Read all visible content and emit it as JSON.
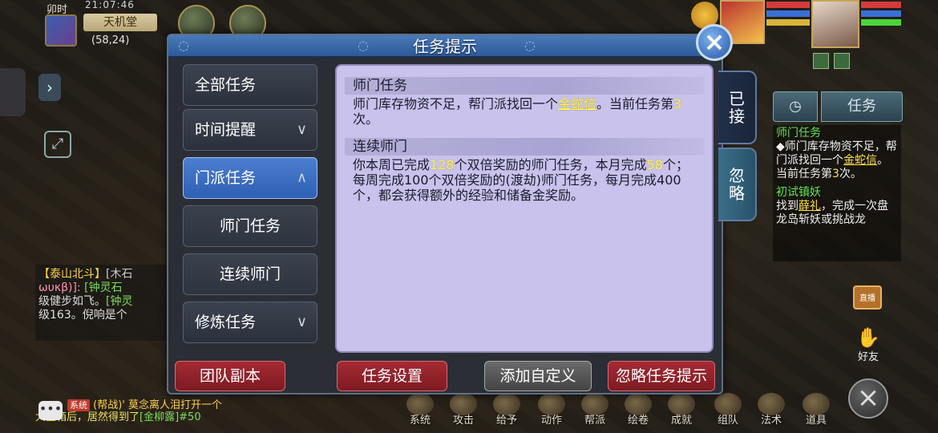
{
  "hud": {
    "time_slot": "卯时",
    "clock": "21:07:46",
    "location": "天机堂",
    "coords": "(58,24)"
  },
  "dialog": {
    "title": "任务提示",
    "categories": [
      {
        "label": "全部任务",
        "chevron": ""
      },
      {
        "label": "时间提醒",
        "chevron": "∨"
      },
      {
        "label": "门派任务",
        "chevron": "∧"
      },
      {
        "label": "师门任务",
        "chevron": ""
      },
      {
        "label": "连续师门",
        "chevron": ""
      },
      {
        "label": "修炼任务",
        "chevron": "∨"
      }
    ],
    "side_tabs": [
      "已接",
      "忽略"
    ],
    "sections": {
      "s1_title": "师门任务",
      "s1_t1": "师门库存物资不足，帮门派找回一个",
      "s1_item": "金蛇信",
      "s1_t2": "。当前任务第",
      "s1_num": "3",
      "s1_t3": "次。",
      "s2_title": "连续师门",
      "s2_t1": "你本周已完成",
      "s2_num1": "128",
      "s2_t2": "个双倍奖励的师门任务，本月完成",
      "s2_num2": "58",
      "s2_t3": "个；每周完成100个双倍奖励的(渡劫)师门任务，每月完成400个，都会获得额外的经验和储备金奖励。"
    },
    "buttons": {
      "team_dungeon": "团队副本",
      "task_settings": "任务设置",
      "add_custom": "添加自定义",
      "ignore_hint": "忽略任务提示"
    }
  },
  "tracker": {
    "timer_icon": "◷",
    "tab_label": "任务",
    "t1_title": "师门任务",
    "t1_a": "◆师门库存物资不足，帮门派找回一个",
    "t1_item": "金蛇信",
    "t1_b": "。当前任务第",
    "t1_num": "3",
    "t1_c": "次。",
    "t2_title": "初试镇妖",
    "t2_a": "找到",
    "t2_item": "薛礼",
    "t2_b": "，完成一次盘龙岛斩妖或挑战龙"
  },
  "chat": {
    "faction_name": "【泰山北斗】",
    "faction_tail": "[木石",
    "l1a": "ωυκβ)]: ",
    "l1b": "[钟灵石",
    "l2a": "级健步如飞。",
    "l2b": "[钟灵",
    "l3": "级163。倪响是个",
    "sys_tag": "系统",
    "b1": "(帮战)' 莫念离人泪打开一个",
    "b2": "大宝箱后，居然得到了",
    "b2_item": "[金柳露]#50"
  },
  "bottom_bar": [
    "系统",
    "攻击",
    "给予",
    "动作",
    "帮派",
    "绘卷",
    "成就",
    "组队",
    "法术",
    "道具"
  ],
  "misc": {
    "tv_label": "直播",
    "friend_label": "好友",
    "close_x": "×",
    "dialog_close_x": "×",
    "left_arrow": "›",
    "expand": "⤢",
    "chat_icon": "•••"
  }
}
